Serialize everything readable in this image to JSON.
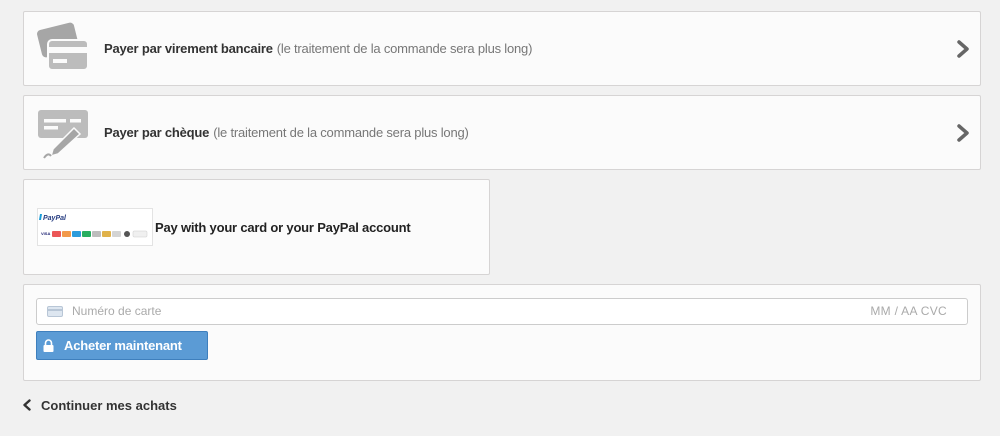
{
  "payment_options": [
    {
      "icon": "bank-card-icon",
      "title": "Payer par virement bancaire",
      "note": "(le traitement de la commande sera plus long)"
    },
    {
      "icon": "cheque-icon",
      "title": "Payer par chèque",
      "note": "(le traitement de la commande sera plus long)"
    }
  ],
  "paypal": {
    "logo_text": "PayPal",
    "card_marks": [
      "VISA"
    ],
    "label": "Pay with your card or your PayPal account"
  },
  "card_form": {
    "card_number_placeholder": "Numéro de carte",
    "expiry_cvc_placeholder": "MM / AA  CVC",
    "buy_button_label": "Acheter maintenant"
  },
  "continue_link": "Continuer mes achats",
  "colors": {
    "button_blue": "#5b9bd5",
    "panel_bg": "#fbfbfb",
    "page_bg": "#f1f1f1"
  }
}
